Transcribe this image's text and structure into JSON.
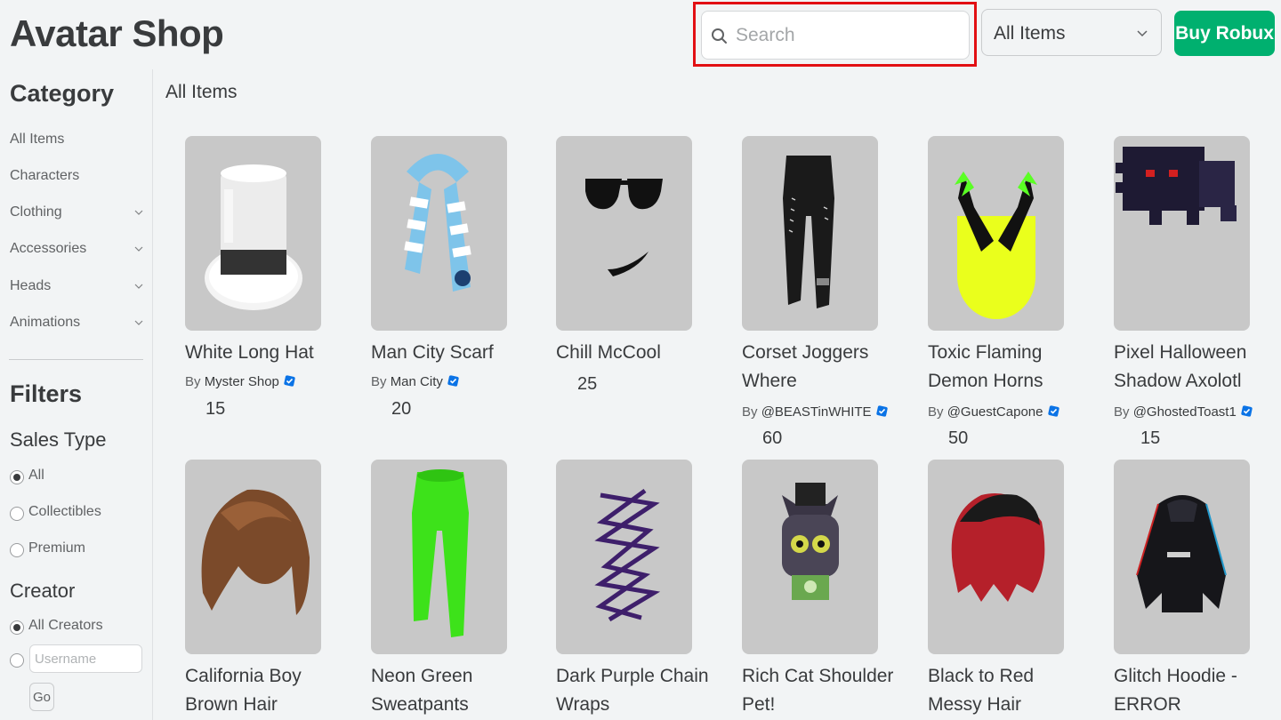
{
  "header": {
    "title": "Avatar Shop",
    "search_placeholder": "Search",
    "filter_select": "All Items",
    "buy_robux": "Buy Robux"
  },
  "sidebar": {
    "category_heading": "Category",
    "categories": [
      "All Items",
      "Characters",
      "Clothing",
      "Accessories",
      "Heads",
      "Animations"
    ],
    "filters_heading": "Filters",
    "sales_type_heading": "Sales Type",
    "sales_types": [
      "All",
      "Collectibles",
      "Premium"
    ],
    "creator_heading": "Creator",
    "creator_all": "All Creators",
    "username_placeholder": "Username",
    "go_label": "Go"
  },
  "main": {
    "section_title": "All Items",
    "items": [
      {
        "name": "White Long Hat",
        "by_prefix": "By",
        "creator": "Myster Shop",
        "price": "15"
      },
      {
        "name": "Man City Scarf",
        "by_prefix": "By",
        "creator": "Man City",
        "price": "20"
      },
      {
        "name": "Chill McCool",
        "by_prefix": "",
        "creator": "",
        "price": "25"
      },
      {
        "name": "Corset Joggers Where",
        "by_prefix": "By",
        "creator": "@BEASTinWHITE",
        "price": "60"
      },
      {
        "name": "Toxic Flaming Demon Horns",
        "by_prefix": "By",
        "creator": "@GuestCapone",
        "price": "50"
      },
      {
        "name": "Pixel Halloween Shadow Axolotl",
        "by_prefix": "By",
        "creator": "@GhostedToast1",
        "price": "15"
      },
      {
        "name": "California Boy Brown Hair",
        "by_prefix": "",
        "creator": "",
        "price": ""
      },
      {
        "name": "Neon Green Sweatpants",
        "by_prefix": "",
        "creator": "",
        "price": ""
      },
      {
        "name": "Dark Purple Chain Wraps",
        "by_prefix": "",
        "creator": "",
        "price": ""
      },
      {
        "name": "Rich Cat Shoulder Pet!",
        "by_prefix": "",
        "creator": "",
        "price": ""
      },
      {
        "name": "Black to Red Messy Hair",
        "by_prefix": "",
        "creator": "",
        "price": ""
      },
      {
        "name": "Glitch Hoodie - ERROR",
        "by_prefix": "",
        "creator": "",
        "price": ""
      }
    ]
  },
  "colors": {
    "accent_green": "#00b06f",
    "highlight_red": "#e20f13",
    "verified_blue": "#0b73e6"
  }
}
